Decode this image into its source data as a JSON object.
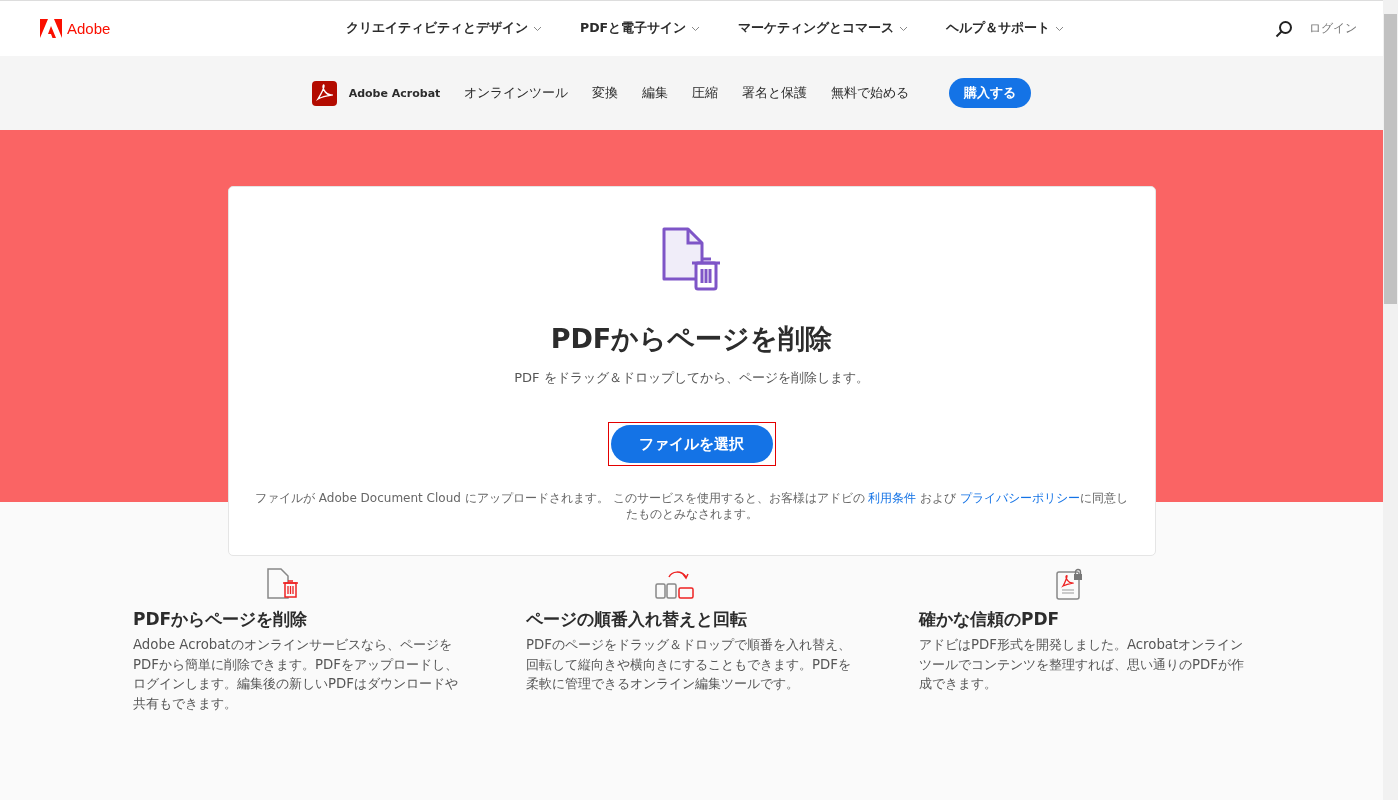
{
  "topnav": {
    "brand": "Adobe",
    "items": [
      {
        "label": "クリエイティビティとデザイン"
      },
      {
        "label": "PDFと電子サイン"
      },
      {
        "label": "マーケティングとコマース"
      },
      {
        "label": "ヘルプ＆サポート"
      }
    ],
    "login": "ログイン"
  },
  "subnav": {
    "product": "Adobe Acrobat",
    "items": [
      "オンラインツール",
      "変換",
      "編集",
      "圧縮",
      "署名と保護",
      "無料で始める"
    ],
    "buy": "購入する"
  },
  "hero": {
    "title": "PDFからページを削除",
    "subtitle": "PDF をドラッグ＆ドロップしてから、ページを削除します。",
    "button": "ファイルを選択",
    "notice": {
      "before": "ファイルが Adobe Document Cloud にアップロードされます。  このサービスを使用すると、お客様はアドビの ",
      "link1": "利用条件",
      "middle": " および ",
      "link2": "プライバシーポリシー",
      "after": "に同意したものとみなされます。"
    }
  },
  "features": [
    {
      "kind": "delete",
      "title": "PDFからページを削除",
      "text": "Adobe Acrobatのオンラインサービスなら、ページをPDFから簡単に削除できます。PDFをアップロードし、ログインします。編集後の新しいPDFはダウンロードや共有もできます。"
    },
    {
      "kind": "reorder",
      "title": "ページの順番入れ替えと回転",
      "text": "PDFのページをドラッグ＆ドロップで順番を入れ替え、回転して縦向きや横向きにすることもできます。PDFを柔軟に管理できるオンライン編集ツールです。"
    },
    {
      "kind": "secure",
      "title": "確かな信頼のPDF",
      "text": "アドビはPDF形式を開発しました。Acrobatオンラインツールでコンテンツを整理すれば、思い通りのPDFが作成できます。"
    }
  ]
}
